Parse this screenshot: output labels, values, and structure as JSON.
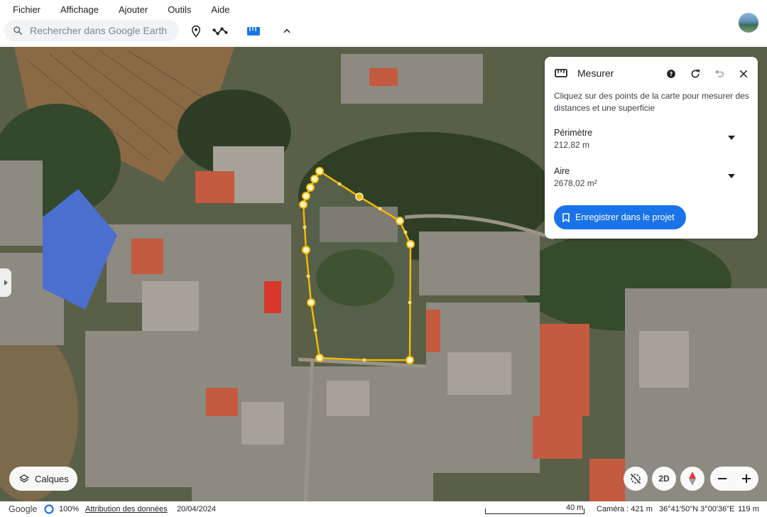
{
  "menu": [
    "Fichier",
    "Affichage",
    "Ajouter",
    "Outils",
    "Aide"
  ],
  "search": {
    "placeholder": "Rechercher dans Google Earth"
  },
  "icons": {
    "search": "search-icon",
    "placemark": "placemark-icon",
    "path": "path-icon",
    "ruler": "ruler-icon",
    "collapse": "chevron-up-icon"
  },
  "measure_panel": {
    "title": "Mesurer",
    "description": "Cliquez sur des points de la carte pour mesurer des distances et une superficie",
    "perimeter_label": "Périmètre",
    "perimeter_value": "212,82 m",
    "area_label": "Aire",
    "area_value": "2678,02 m²",
    "save_label": "Enregistrer dans le projet"
  },
  "controls": {
    "layers_label": "Calques",
    "view_2d_label": "2D"
  },
  "status": {
    "brand": "Google",
    "load_percent": "100%",
    "attribution": "Attribution des données",
    "date": "20/04/2024",
    "scale": "40 m",
    "camera": "Caméra : 421 m",
    "coordinates": "36°41'50\"N 3°00'36\"E",
    "altitude": "119 m"
  },
  "colors": {
    "accent": "#1a73e8",
    "polygon": "#f5b800"
  }
}
